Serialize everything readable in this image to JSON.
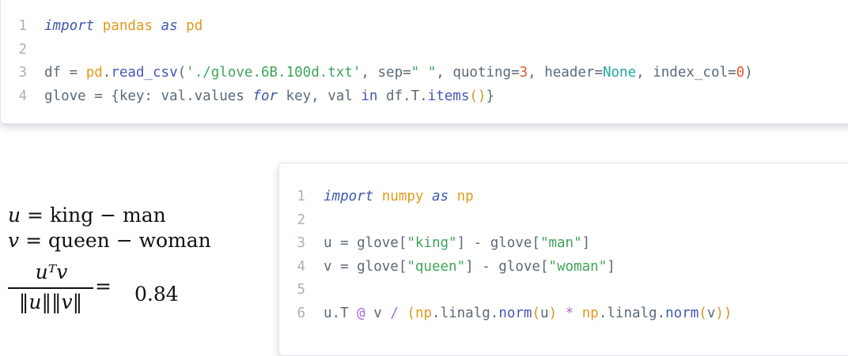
{
  "code_block_1": {
    "lines": [
      {
        "n": "1",
        "text": "import pandas as pd"
      },
      {
        "n": "2",
        "text": ""
      },
      {
        "n": "3",
        "text": "df = pd.read_csv('./glove.6B.100d.txt', sep=\" \", quoting=3, header=None, index_col=0)"
      },
      {
        "n": "4",
        "text": "glove = {key: val.values for key, val in df.T.items()}"
      }
    ]
  },
  "code_block_2": {
    "lines": [
      {
        "n": "1",
        "text": "import numpy as np"
      },
      {
        "n": "2",
        "text": ""
      },
      {
        "n": "3",
        "text": "u = glove[\"king\"] - glove[\"man\"]"
      },
      {
        "n": "4",
        "text": "v = glove[\"queen\"] - glove[\"woman\"]"
      },
      {
        "n": "5",
        "text": ""
      },
      {
        "n": "6",
        "text": "u.T @ v / (np.linalg.norm(u) * np.linalg.norm(v))"
      }
    ]
  },
  "math": {
    "eq1_lhs": "u",
    "eq1_rhs_a": "king",
    "eq1_rhs_b": "man",
    "eq2_lhs": "v",
    "eq2_rhs_a": "queen",
    "eq2_rhs_b": "woman",
    "frac_num": "uᵀv",
    "frac_den": "‖u‖‖v‖",
    "result": "0.84"
  },
  "colors": {
    "keyword": "#3f57b3",
    "module": "#e09a1e",
    "string": "#40a55b",
    "number": "#e4582a",
    "constant": "#22a6a0",
    "line_number": "#a9b2bc"
  }
}
